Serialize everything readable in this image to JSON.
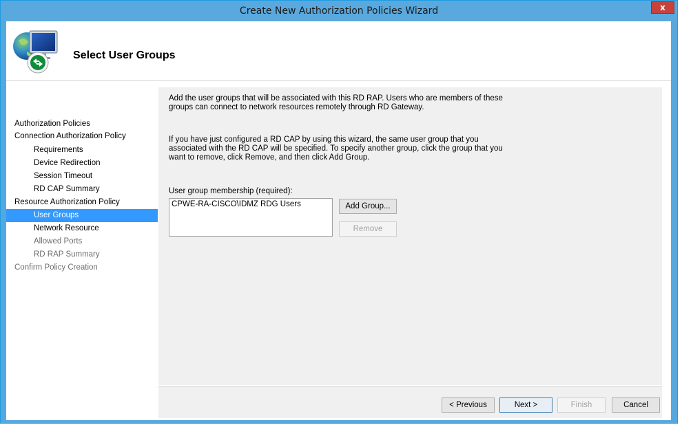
{
  "window": {
    "title": "Create New Authorization Policies Wizard",
    "close_glyph": "x"
  },
  "header": {
    "title": "Select User Groups",
    "icon": "rd-gateway-computer-icon"
  },
  "nav": {
    "items": [
      {
        "label": "Authorization Policies"
      },
      {
        "label": "Connection Authorization Policy"
      },
      {
        "label": "Requirements"
      },
      {
        "label": "Device Redirection"
      },
      {
        "label": "Session Timeout"
      },
      {
        "label": "RD CAP Summary"
      },
      {
        "label": "Resource Authorization Policy"
      },
      {
        "label": "User Groups"
      },
      {
        "label": "Network Resource"
      },
      {
        "label": "Allowed Ports"
      },
      {
        "label": "RD RAP Summary"
      },
      {
        "label": "Confirm Policy Creation"
      }
    ],
    "selected_color": "#3399ff"
  },
  "main": {
    "intro": "Add the user groups that will be associated with this RD RAP. Users who are members of these\ngroups can connect to network resources remotely through RD Gateway.",
    "note": "If you have just configured a RD CAP by using this wizard, the same user group that you\nassociated with the RD CAP will be specified. To specify another group, click the group that you\nwant to remove, click Remove, and then click Add Group.",
    "group_label": "User group membership (required):",
    "groups": [
      "CPWE-RA-CISCO\\IDMZ RDG Users"
    ],
    "add_button": "Add Group...",
    "remove_button": "Remove"
  },
  "footer": {
    "previous": "< Previous",
    "next": "Next >",
    "finish": "Finish",
    "cancel": "Cancel"
  }
}
